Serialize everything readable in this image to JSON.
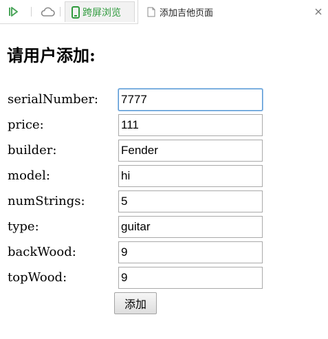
{
  "browser": {
    "tabs": [
      {
        "label": "跨屏浏览",
        "icon": "phone-icon",
        "color": "#2e9a3c"
      },
      {
        "label": "添加吉他页面",
        "icon": "page-icon",
        "active": true
      }
    ]
  },
  "page": {
    "title": "请用户添加:"
  },
  "form": {
    "fields": [
      {
        "label": "serialNumber:",
        "value": "7777",
        "focused": true
      },
      {
        "label": "price:",
        "value": "111"
      },
      {
        "label": "builder:",
        "value": "Fender"
      },
      {
        "label": "model:",
        "value": "hi"
      },
      {
        "label": "numStrings:",
        "value": "5"
      },
      {
        "label": "type:",
        "value": "guitar"
      },
      {
        "label": "backWood:",
        "value": "9"
      },
      {
        "label": "topWood:",
        "value": "9"
      }
    ],
    "submit_label": "添加"
  },
  "colors": {
    "accent_green": "#2e9a3c",
    "focus_border": "#5b9bd5"
  }
}
